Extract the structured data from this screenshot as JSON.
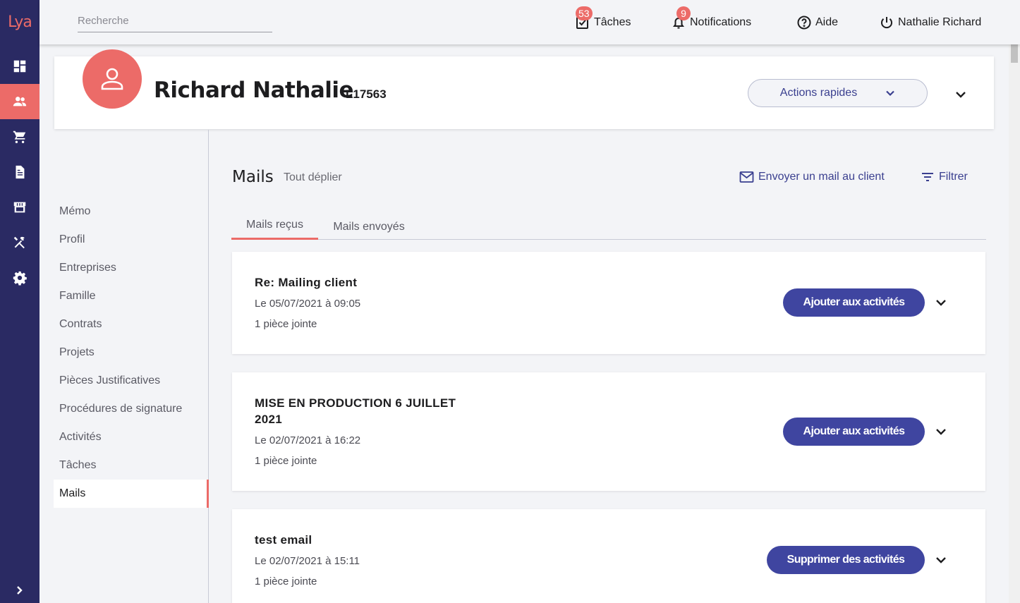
{
  "app": {
    "logo_text": "Lya"
  },
  "rail": {
    "items": [
      {
        "name": "dashboard",
        "icon": "dashboard-icon"
      },
      {
        "name": "clients",
        "icon": "people-icon",
        "active": true
      },
      {
        "name": "shop",
        "icon": "cart-icon"
      },
      {
        "name": "documents",
        "icon": "document-icon"
      },
      {
        "name": "store",
        "icon": "storefront-icon"
      },
      {
        "name": "tools",
        "icon": "tools-icon"
      },
      {
        "name": "settings",
        "icon": "gear-icon"
      }
    ],
    "expand_icon": "chevron-right-icon"
  },
  "topbar": {
    "search_placeholder": "Recherche",
    "tasks_label": "Tâches",
    "tasks_count": "53",
    "notifications_label": "Notifications",
    "notifications_count": "9",
    "help_label": "Aide",
    "user_label": "Nathalie Richard"
  },
  "client": {
    "name": "Richard Nathalie",
    "code": "L17563",
    "quick_actions_label": "Actions rapides"
  },
  "sidenav": {
    "items": [
      {
        "label": "Mémo"
      },
      {
        "label": "Profil"
      },
      {
        "label": "Entreprises"
      },
      {
        "label": "Famille"
      },
      {
        "label": "Contrats"
      },
      {
        "label": "Projets"
      },
      {
        "label": "Pièces Justificatives"
      },
      {
        "label": "Procédures de signature"
      },
      {
        "label": "Activités"
      },
      {
        "label": "Tâches"
      },
      {
        "label": "Mails",
        "active": true
      }
    ]
  },
  "mails": {
    "title": "Mails",
    "expand_all": "Tout déplier",
    "send_mail": "Envoyer un mail au client",
    "filter": "Filtrer",
    "tabs": [
      {
        "label": "Mails reçus",
        "active": true
      },
      {
        "label": "Mails envoyés"
      }
    ],
    "items": [
      {
        "subject": "Re: Mailing client",
        "date": "Le 05/07/2021 à 09:05",
        "attachments": "1 pièce jointe",
        "action": "Ajouter aux activités"
      },
      {
        "subject": "MISE EN PRODUCTION 6 JUILLET 2021",
        "date": "Le 02/07/2021 à 16:22",
        "attachments": "1 pièce jointe",
        "action": "Ajouter aux activités"
      },
      {
        "subject": "test email",
        "date": "Le 02/07/2021 à 15:11",
        "attachments": "1 pièce jointe",
        "action": "Supprimer des activités"
      }
    ]
  },
  "colors": {
    "accent": "#ec6b68",
    "primary": "#3f45a0",
    "rail": "#2a2a63"
  }
}
